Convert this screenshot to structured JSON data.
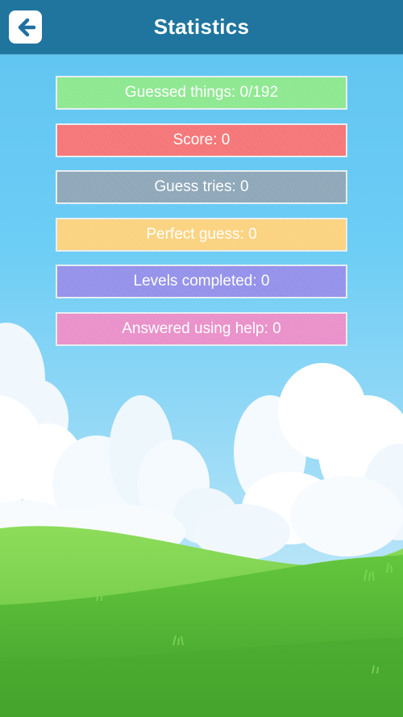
{
  "header": {
    "title": "Statistics",
    "back_icon": "arrow-left-icon",
    "bar_color": "#1f759e"
  },
  "stats": [
    {
      "label": "Guessed things: 0/192",
      "color": "#8ce88f"
    },
    {
      "label": "Score: 0",
      "color": "#f57476"
    },
    {
      "label": "Guess tries: 0",
      "color": "#8da6b8"
    },
    {
      "label": "Perfect guess: 0",
      "color": "#fbd27e"
    },
    {
      "label": "Levels completed: 0",
      "color": "#9390ea"
    },
    {
      "label": "Answered using help: 0",
      "color": "#e98fc9"
    }
  ],
  "theme": {
    "sky_color": "#6ccdf5",
    "grass_color": "#5fbf3c"
  }
}
